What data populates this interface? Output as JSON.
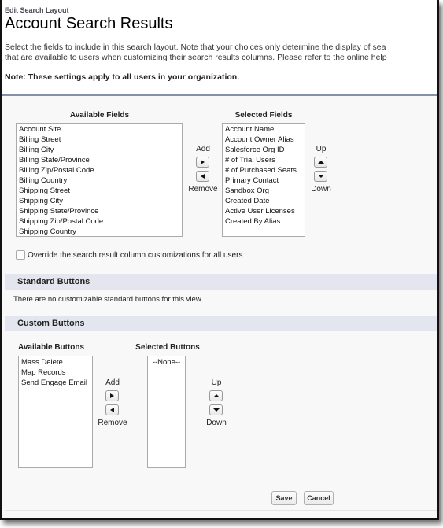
{
  "header": {
    "breadcrumb": "Edit Search Layout",
    "title": "Account Search Results",
    "description_line1": "Select the fields to include in this search layout. Note that your choices only determine the display of sea",
    "description_line2": "that are available to users when customizing their search results columns. Please refer to the online help",
    "note": "Note: These settings apply to all users in your organization."
  },
  "fields": {
    "available_title": "Available Fields",
    "selected_title": "Selected Fields",
    "available": [
      "Account Site",
      "Billing Street",
      "Billing City",
      "Billing State/Province",
      "Billing Zip/Postal Code",
      "Billing Country",
      "Shipping Street",
      "Shipping City",
      "Shipping State/Province",
      "Shipping Zip/Postal Code",
      "Shipping Country"
    ],
    "selected": [
      "Account Name",
      "Account Owner Alias",
      "Salesforce Org ID",
      "# of Trial Users",
      "# of Purchased Seats",
      "Primary Contact",
      "Sandbox Org",
      "Created Date",
      "Active User Licenses",
      "Created By Alias"
    ],
    "add_label": "Add",
    "remove_label": "Remove",
    "up_label": "Up",
    "down_label": "Down"
  },
  "override_checkbox": {
    "label": "Override the search result column customizations for all users",
    "checked": false
  },
  "standard_buttons": {
    "title": "Standard Buttons",
    "message": "There are no customizable standard buttons for this view."
  },
  "custom_buttons": {
    "title": "Custom Buttons",
    "available_title": "Available Buttons",
    "selected_title": "Selected Buttons",
    "available": [
      "Mass Delete",
      "Map Records",
      "Send Engage Email"
    ],
    "selected": [
      "--None--"
    ],
    "add_label": "Add",
    "remove_label": "Remove",
    "up_label": "Up",
    "down_label": "Down"
  },
  "footer": {
    "save_label": "Save",
    "cancel_label": "Cancel"
  }
}
